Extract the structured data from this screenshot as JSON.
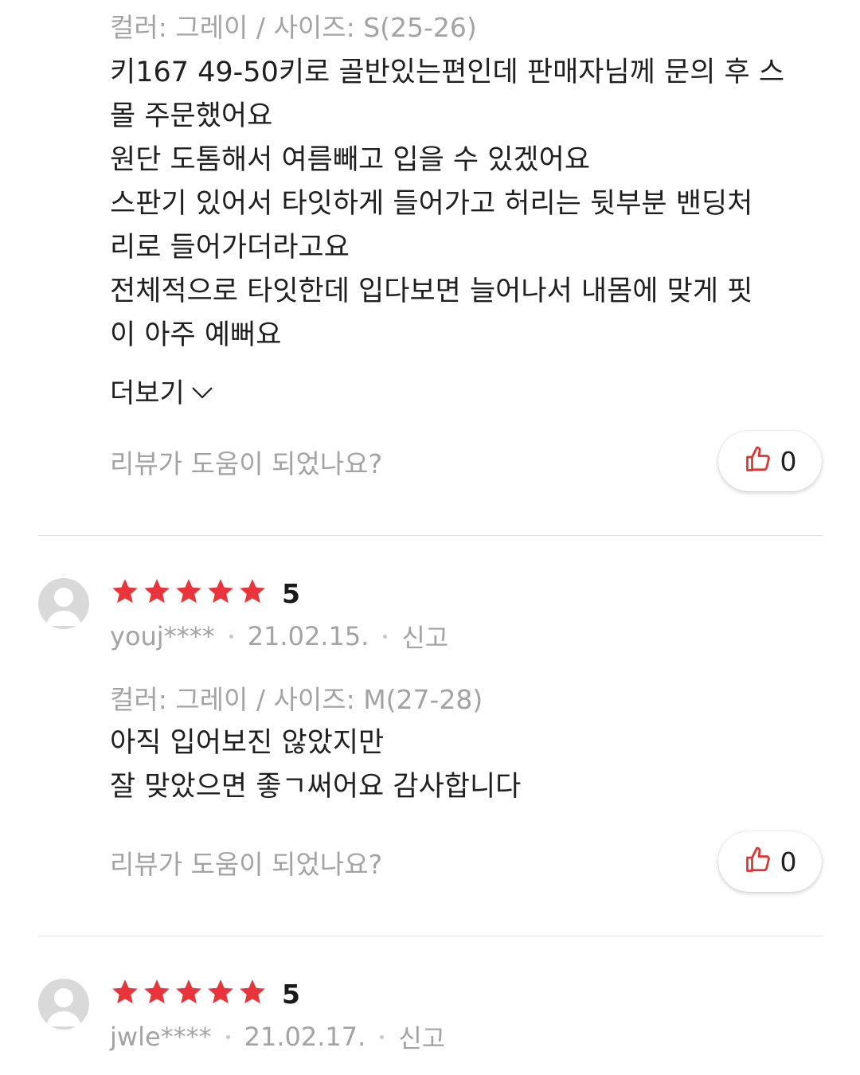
{
  "reviews": [
    {
      "option": "컬러: 그레이 / 사이즈: S(25-26)",
      "lines": [
        "키167 49-50키로 골반있는편인데 판매자님께 문의 후 스",
        "몰 주문했어요",
        "원단 도톰해서 여름빼고 입을 수 있겠어요",
        "스판기 있어서 타잇하게 들어가고 허리는 뒷부분 밴딩처",
        "리로 들어가더라고요",
        "전체적으로 타잇한데 입다보면 늘어나서 내몸에 맞게 핏",
        "이 아주 예뻐요"
      ],
      "more_label": "더보기",
      "helpful_question": "리뷰가 도움이 되었나요?",
      "like_count": "0"
    },
    {
      "rating": 5,
      "rating_text": "5",
      "user": "youj****",
      "date": "21.02.15.",
      "report": "신고",
      "option": "컬러: 그레이 / 사이즈: M(27-28)",
      "lines": [
        "아직 입어보진 않았지만",
        "잘 맞았으면 좋ㄱ써어요 감사합니다"
      ],
      "helpful_question": "리뷰가 도움이 되었나요?",
      "like_count": "0"
    },
    {
      "rating": 5,
      "rating_text": "5",
      "user": "jwle****",
      "date": "21.02.17.",
      "report": "신고"
    }
  ],
  "colors": {
    "star": "#e8343a",
    "like_icon": "#e0322f",
    "muted_text": "#a3a3a3"
  },
  "icons": {
    "star": "star-icon",
    "thumbs_up": "thumbs-up-icon",
    "chevron": "chevron-down-icon",
    "avatar": "default-avatar-icon"
  }
}
